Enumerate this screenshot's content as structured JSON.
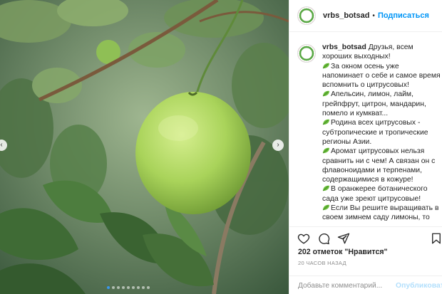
{
  "post": {
    "username": "vrbs_botsad",
    "separator": "•",
    "follow_label": "Подписаться"
  },
  "caption": {
    "username": "vrbs_botsad",
    "intro": "Друзья, всем хороших выходных!",
    "paragraphs": [
      "За окном осень уже напоминает о себе и самое время вспомнить о цитрусовых!",
      "Апельсин, лимон, лайм, грейпфрут, цитрон, мандарин, помело и кумкват...",
      "Родина всех цитрусовых - субтропические и тропические регионы Азии.",
      "Аромат цитрусовых нельзя сравнить ни с чем! А связан он с флавоноидами и терпенами, содержащимися в кожуре!",
      "В оранжерее ботанического сада уже зреют цитрусовые!",
      "Если Вы решите выращивать в своем зимнем саду лимоны, то самыми подходящими сортами"
    ]
  },
  "stats": {
    "likes_text": "202 отметок \"Нравится\"",
    "time_text": "20 ЧАСОВ НАЗАД"
  },
  "comment_box": {
    "placeholder": "Добавьте комментарий...",
    "publish_label": "Опубликовать"
  },
  "carousel": {
    "slide_count": 9,
    "active_index": 0
  },
  "colors": {
    "accent": "#0095f6",
    "publish_disabled": "#b2dffc",
    "leaf_emoji": "#6abf3b"
  },
  "icons": {
    "like": "heart-icon",
    "comment": "comment-icon",
    "share": "share-icon",
    "save": "bookmark-icon",
    "leaf": "leaf-emoji-icon",
    "prev": "chevron-left-icon",
    "next": "chevron-right-icon"
  }
}
